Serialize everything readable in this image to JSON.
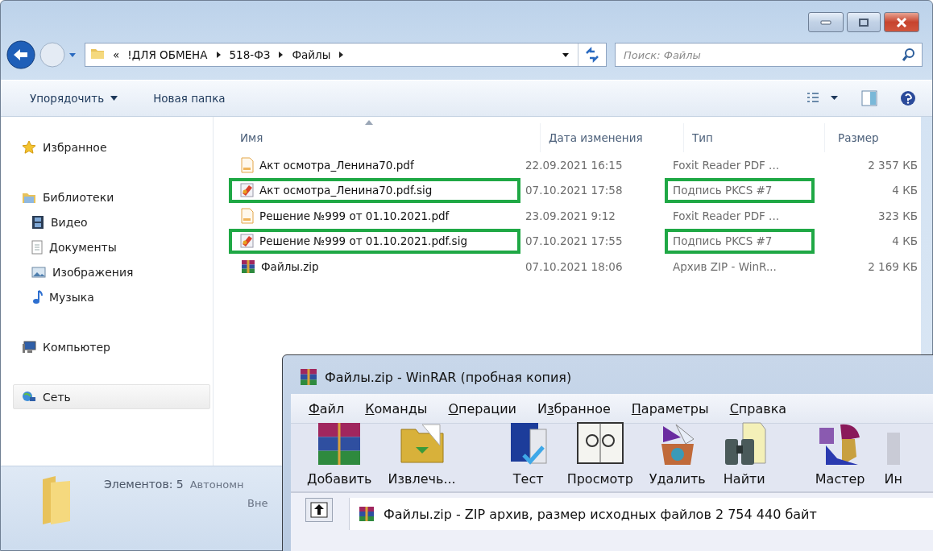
{
  "explorer": {
    "address": {
      "overflow": "«",
      "crumbs": [
        "!ДЛЯ ОБМЕНА",
        "518-ФЗ",
        "Файлы"
      ]
    },
    "search": {
      "placeholder": "Поиск: Файлы"
    },
    "commands": [
      {
        "label": "Упорядочить",
        "kind": "menu"
      },
      {
        "label": "Новая папка",
        "kind": "button"
      }
    ],
    "sidebar": [
      {
        "label": "Избранное",
        "kind": "favorites",
        "selected": false
      },
      {
        "label": "Библиотеки",
        "kind": "libraries",
        "selected": false,
        "children": [
          {
            "label": "Видео",
            "kind": "video",
            "selected": false
          },
          {
            "label": "Документы",
            "kind": "documents",
            "selected": false
          },
          {
            "label": "Изображения",
            "kind": "pictures",
            "selected": false
          },
          {
            "label": "Музыка",
            "kind": "music",
            "selected": false
          }
        ]
      },
      {
        "label": "Компьютер",
        "kind": "computer",
        "selected": false
      },
      {
        "label": "Сеть",
        "kind": "network",
        "selected": true
      }
    ],
    "columns": [
      {
        "label": "Имя",
        "sorted": true
      },
      {
        "label": "Дата изменения",
        "sorted": false
      },
      {
        "label": "Тип",
        "sorted": false
      },
      {
        "label": "Размер",
        "sorted": false
      }
    ],
    "rows": [
      {
        "name": "Акт осмотра_Ленина70.pdf",
        "date": "22.09.2021 16:15",
        "type": "Foxit Reader PDF ...",
        "size": "2 357 КБ",
        "kind": "pdf",
        "highlighted": false
      },
      {
        "name": "Акт осмотра_Ленина70.pdf.sig",
        "date": "07.10.2021 17:58",
        "type": "Подпись PKCS #7",
        "size": "4 КБ",
        "kind": "sig",
        "highlighted": true
      },
      {
        "name": "Решение №999 от 01.10.2021.pdf",
        "date": "23.09.2021 9:12",
        "type": "Foxit Reader PDF ...",
        "size": "323 КБ",
        "kind": "pdf",
        "highlighted": false
      },
      {
        "name": "Решение №999 от 01.10.2021.pdf.sig",
        "date": "07.10.2021 17:55",
        "type": "Подпись PKCS #7",
        "size": "4 КБ",
        "kind": "sig",
        "highlighted": true
      },
      {
        "name": "Файлы.zip",
        "date": "07.10.2021 18:06",
        "type": "Архив ZIP - WinR...",
        "size": "2 169 КБ",
        "kind": "zip",
        "highlighted": false
      }
    ],
    "status": {
      "count": "Элементов: 5",
      "state": "Автономн",
      "line2": "Вне"
    }
  },
  "winrar": {
    "title": "Файлы.zip - WinRAR (пробная копия)",
    "menu": [
      {
        "key": "Ф",
        "post": "айл"
      },
      {
        "key": "К",
        "post": "оманды"
      },
      {
        "key": "О",
        "post": "перации"
      },
      {
        "pre": "И",
        "key": "з",
        "post": "бранное"
      },
      {
        "key": "П",
        "post": "араметры"
      },
      {
        "key": "С",
        "post": "правка"
      }
    ],
    "tools": [
      {
        "label": "Добавить",
        "kind": "add"
      },
      {
        "label": "Извлечь...",
        "kind": "extract"
      },
      {
        "label": "Тест",
        "kind": "test"
      },
      {
        "label": "Просмотр",
        "kind": "view"
      },
      {
        "label": "Удалить",
        "kind": "delete"
      },
      {
        "label": "Найти",
        "kind": "find"
      },
      {
        "label": "Мастер",
        "kind": "wizard"
      },
      {
        "label": "Ин",
        "kind": "info"
      }
    ],
    "path": "Файлы.zip - ZIP архив, размер исходных файлов 2 754 440 байт"
  }
}
